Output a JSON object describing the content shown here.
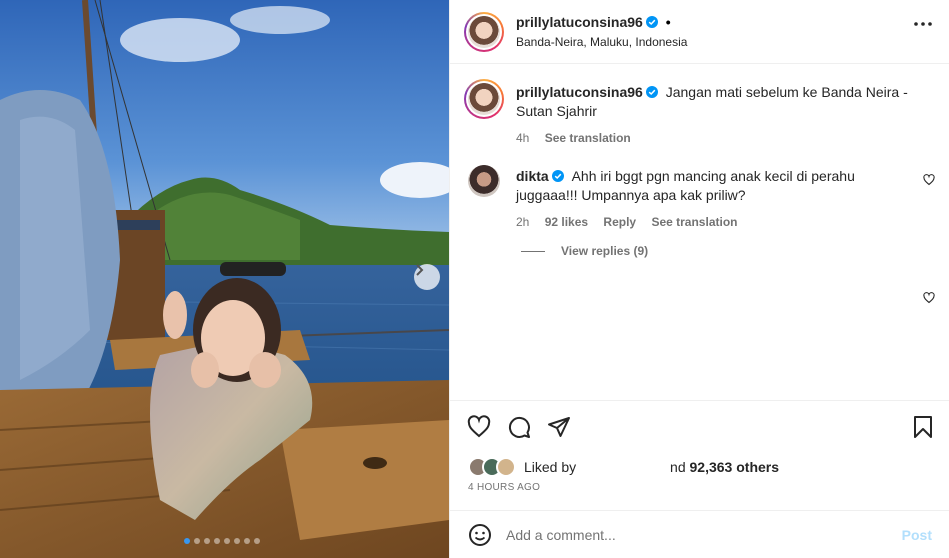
{
  "header": {
    "username": "prillylatuconsina96",
    "location": "Banda-Neira, Maluku, Indonesia",
    "separator": "•"
  },
  "caption": {
    "username": "prillylatuconsina96",
    "text": "Jangan mati sebelum ke Banda Neira - Sutan Sjahrir",
    "time": "4h",
    "see_translation": "See translation"
  },
  "comment": {
    "username": "dikta",
    "text": "Ahh iri bggt pgn mancing anak kecil di perahu juggaaa!!! Umpannya apa kak priliw?",
    "time": "2h",
    "likes": "92 likes",
    "reply": "Reply",
    "see_translation": "See translation"
  },
  "view_replies": "View replies (9)",
  "likes": {
    "prefix": "Liked by",
    "suffix": "nd",
    "count": "92,363 others"
  },
  "time_ago": "4 HOURS AGO",
  "add_comment": {
    "placeholder": "Add a comment...",
    "post_label": "Post"
  },
  "carousel": {
    "total_dots": 8,
    "active_index": 0
  },
  "colors": {
    "verified": "#0095f6",
    "post_disabled": "#b2dffc",
    "muted": "#737373"
  }
}
